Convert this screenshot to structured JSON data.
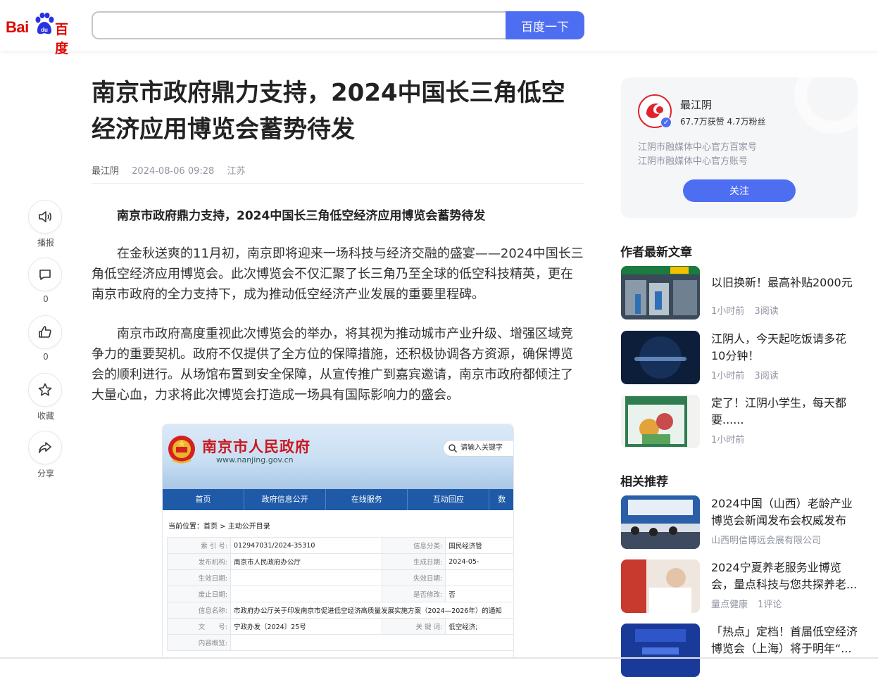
{
  "header": {
    "logo_latin": "Bai",
    "logo_cn": "百度",
    "search_placeholder": "",
    "search_button": "百度一下"
  },
  "article": {
    "title": "南京市政府鼎力支持，2024中国长三角低空经济应用博览会蓄势待发",
    "author": "最江阴",
    "datetime": "2024-08-06 09:28",
    "location": "江苏",
    "lead": "南京市政府鼎力支持，2024中国长三角低空经济应用博览会蓄势待发",
    "paragraphs": [
      "在金秋送爽的11月初，南京即将迎来一场科技与经济交融的盛宴——2024中国长三角低空经济应用博览会。此次博览会不仅汇聚了长三角乃至全球的低空科技精英，更在南京市政府的全力支持下，成为推动低空经济产业发展的重要里程碑。",
      "南京市政府高度重视此次博览会的举办，将其视为推动城市产业升级、增强区域竞争力的重要契机。政府不仅提供了全方位的保障措施，还积极协调各方资源，确保博览会的顺利进行。从场馆布置到安全保障，从宣传推广到嘉宾邀请，南京市政府都倾注了大量心血，力求将此次博览会打造成一场具有国际影响力的盛会。"
    ]
  },
  "actions": {
    "listen": "播报",
    "comment_count": "0",
    "like_count": "0",
    "favorite": "收藏",
    "share": "分享"
  },
  "figure": {
    "site_title": "南京市人民政府",
    "site_url": "www.nanjing.gov.cn",
    "search_placeholder": "请输入关键字",
    "nav": [
      "首页",
      "政府信息公开",
      "在线服务",
      "互动回应",
      "数"
    ],
    "breadcrumb": "当前位置：首页 > 主动公开目录",
    "rows": [
      {
        "k1": "索 引 号:",
        "v1": "012947031/2024-35310",
        "k2": "信息分类:",
        "v2": "国民经济管"
      },
      {
        "k1": "发布机构:",
        "v1": "南京市人民政府办公厅",
        "k2": "生成日期:",
        "v2": "2024-05-"
      },
      {
        "k1": "生效日期:",
        "v1": "",
        "k2": "失效日期:",
        "v2": ""
      },
      {
        "k1": "废止日期:",
        "v1": "",
        "k2": "是否修改:",
        "v2": "否"
      },
      {
        "k1": "信息名称:",
        "v1": "市政府办公厅关于印发南京市促进低空经济高质量发展实施方案（2024—2026年）的通知",
        "k2": "",
        "v2": ""
      },
      {
        "k1": "文　　号:",
        "v1": "宁政办发〔2024〕25号",
        "k2": "关 键 词:",
        "v2": "低空经济;"
      },
      {
        "k1": "内容概览:",
        "v1": "",
        "k2": "",
        "v2": ""
      }
    ]
  },
  "author_card": {
    "name": "最江阴",
    "stats": "67.7万获赞 4.7万粉丝",
    "desc1": "江阴市融媒体中心官方百家号",
    "desc2": "江阴市融媒体中心官方账号",
    "follow": "关注"
  },
  "latest": {
    "title": "作者最新文章",
    "items": [
      {
        "title": "以旧换新！最高补贴2000元",
        "time": "1小时前",
        "reads": "3阅读"
      },
      {
        "title": "江阴人，今天起吃饭请多花10分钟！",
        "time": "1小时前",
        "reads": "3阅读"
      },
      {
        "title": "定了！江阴小学生，每天都要......",
        "time": "1小时前",
        "reads": ""
      }
    ]
  },
  "related": {
    "title": "相关推荐",
    "items": [
      {
        "title": "2024中国（山西）老龄产业博览会新闻发布会权威发布",
        "source": "山西明信博远会展有限公司",
        "extra": ""
      },
      {
        "title": "2024宁夏养老服务业博览会，量点科技与您共探养老...",
        "source": "量点健康",
        "extra": "1评论"
      },
      {
        "title": "「热点」定档！首届低空经济博览会（上海）将于明年“...",
        "source": "",
        "extra": ""
      }
    ]
  },
  "colors": {
    "brand_red": "#e10601",
    "accent_blue": "#4e6ef2"
  }
}
